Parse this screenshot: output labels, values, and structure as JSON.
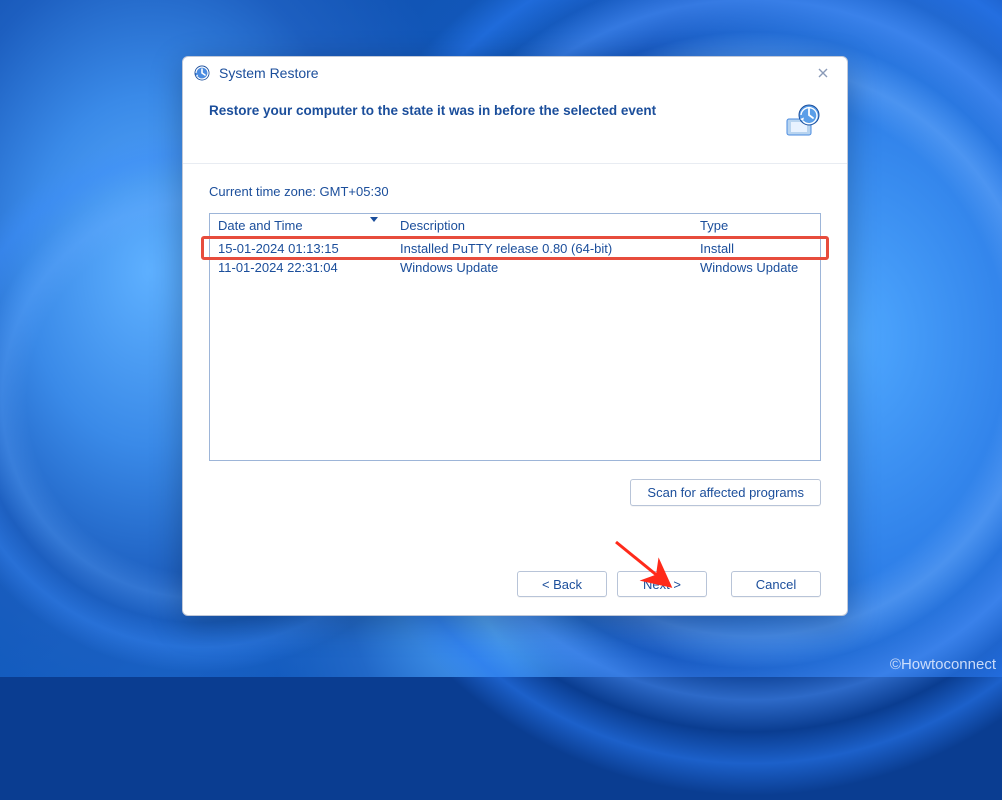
{
  "dialog": {
    "title": "System Restore",
    "heading": "Restore your computer to the state it was in before the selected event",
    "timezone_label": "Current time zone: GMT+05:30",
    "columns": {
      "date_time": "Date and Time",
      "description": "Description",
      "type": "Type"
    },
    "rows": [
      {
        "date_time": "15-01-2024 01:13:15",
        "description": "Installed PuTTY release 0.80 (64-bit)",
        "type": "Install"
      },
      {
        "date_time": "11-01-2024 22:31:04",
        "description": "Windows Update",
        "type": "Windows Update"
      }
    ],
    "scan_button": "Scan for affected programs",
    "buttons": {
      "back": "< Back",
      "next": "Next >",
      "cancel": "Cancel"
    }
  },
  "watermark": "©Howtoconnect",
  "colors": {
    "dialog_text": "#1b4e9b",
    "highlight": "#e74c3c",
    "arrow": "#ff2a1a"
  }
}
